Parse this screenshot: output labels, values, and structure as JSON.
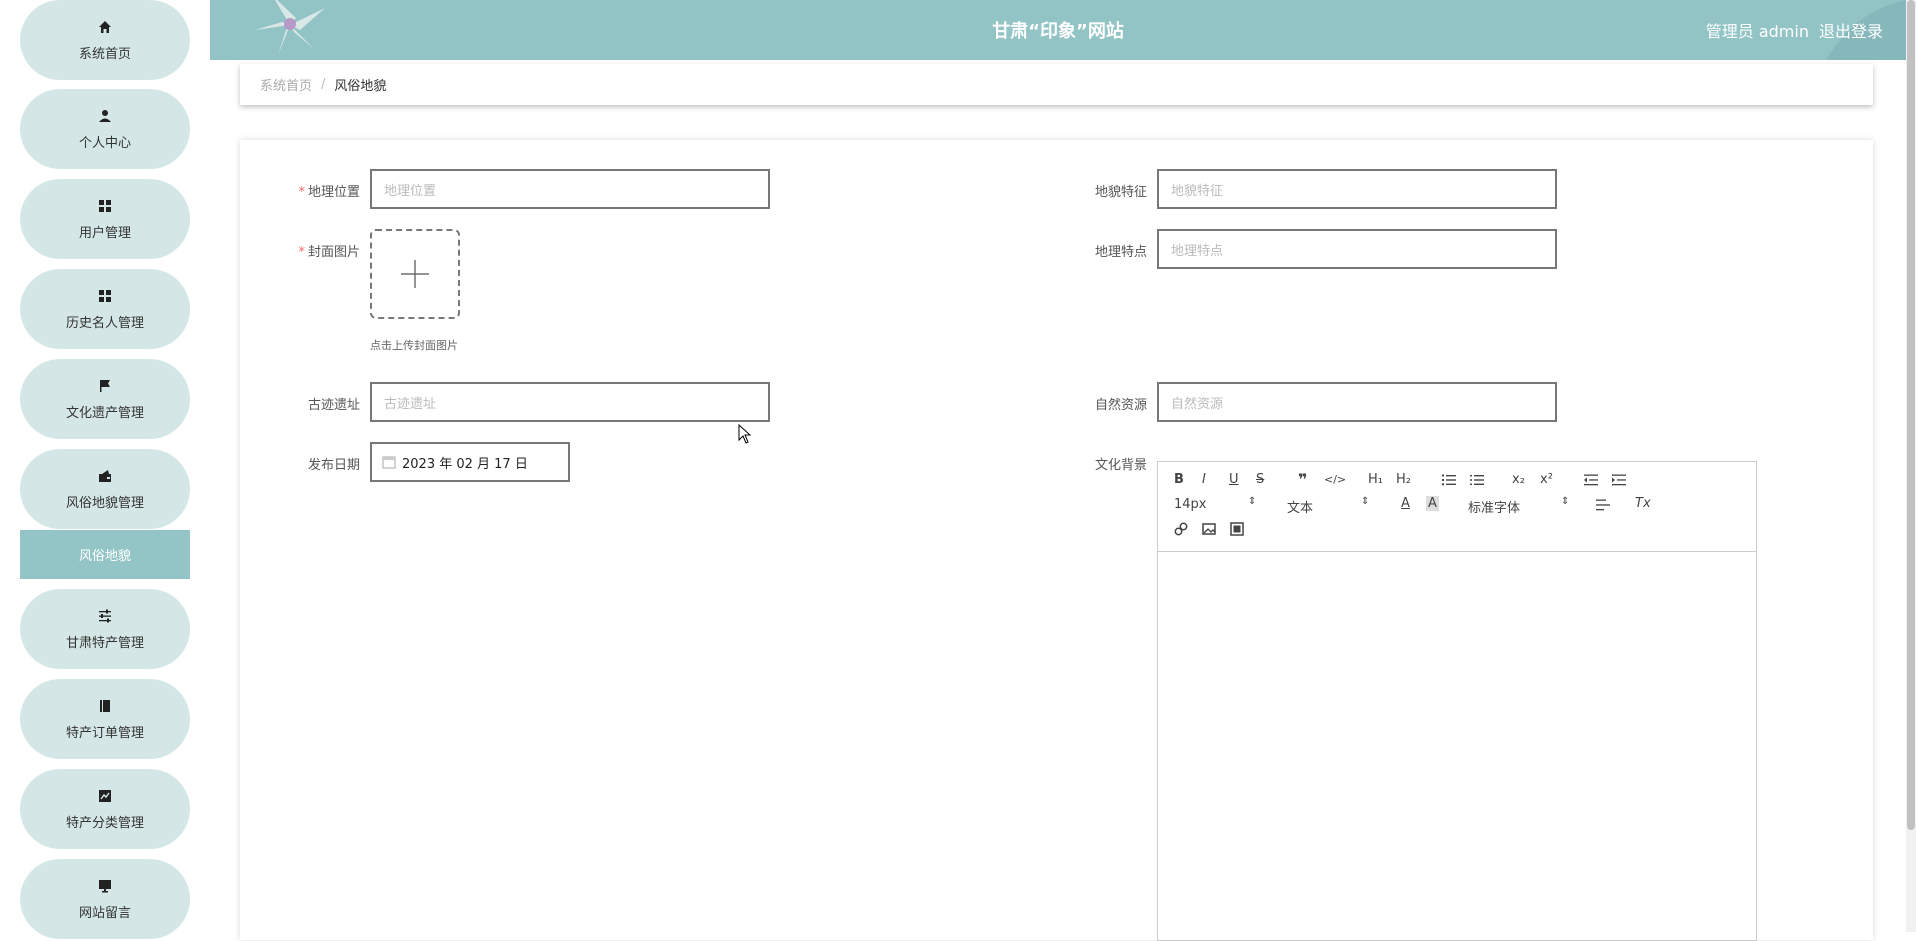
{
  "header": {
    "title": "甘肃“印象”网站",
    "user": "管理员 admin",
    "logout": "退出登录"
  },
  "sidebar": {
    "items": [
      {
        "label": "系统首页",
        "icon": "home-icon"
      },
      {
        "label": "个人中心",
        "icon": "user-icon"
      },
      {
        "label": "用户管理",
        "icon": "grid-icon"
      },
      {
        "label": "历史名人管理",
        "icon": "grid-icon"
      },
      {
        "label": "文化遗产管理",
        "icon": "flag-icon"
      },
      {
        "label": "风俗地貌管理",
        "icon": "wallet-icon"
      },
      {
        "label": "甘肃特产管理",
        "icon": "sliders-icon"
      },
      {
        "label": "特产订单管理",
        "icon": "book-icon"
      },
      {
        "label": "特产分类管理",
        "icon": "chart-icon"
      },
      {
        "label": "网站留言",
        "icon": "monitor-icon"
      }
    ],
    "sub_item": "风俗地貌"
  },
  "breadcrumb": {
    "home": "系统首页",
    "separator": "/",
    "current": "风俗地貌"
  },
  "form": {
    "location": {
      "label": "地理位置",
      "placeholder": "地理位置",
      "required": true
    },
    "landform": {
      "label": "地貌特征",
      "placeholder": "地貌特征"
    },
    "cover": {
      "label": "封面图片",
      "tip": "点击上传封面图片",
      "required": true
    },
    "geo_features": {
      "label": "地理特点",
      "placeholder": "地理特点"
    },
    "ruins": {
      "label": "古迹遗址",
      "placeholder": "古迹遗址"
    },
    "resources": {
      "label": "自然资源",
      "placeholder": "自然资源"
    },
    "date": {
      "label": "发布日期",
      "value": "2023 年 02 月 17 日"
    },
    "culture": {
      "label": "文化背景"
    }
  },
  "editor": {
    "font_size": "14px",
    "paragraph": "文本",
    "font_family": "标准字体",
    "buttons_row1": [
      "B",
      "I",
      "U",
      "S",
      "❞",
      "</>",
      "H1",
      "H2",
      "ol",
      "ul",
      "x₂",
      "x²",
      "outdent",
      "indent"
    ]
  },
  "colors": {
    "header_bg": "#92c3c5",
    "nav_bg": "#d4e7e6",
    "nav_active": "#93c4c6",
    "required": "#f56c6c"
  }
}
